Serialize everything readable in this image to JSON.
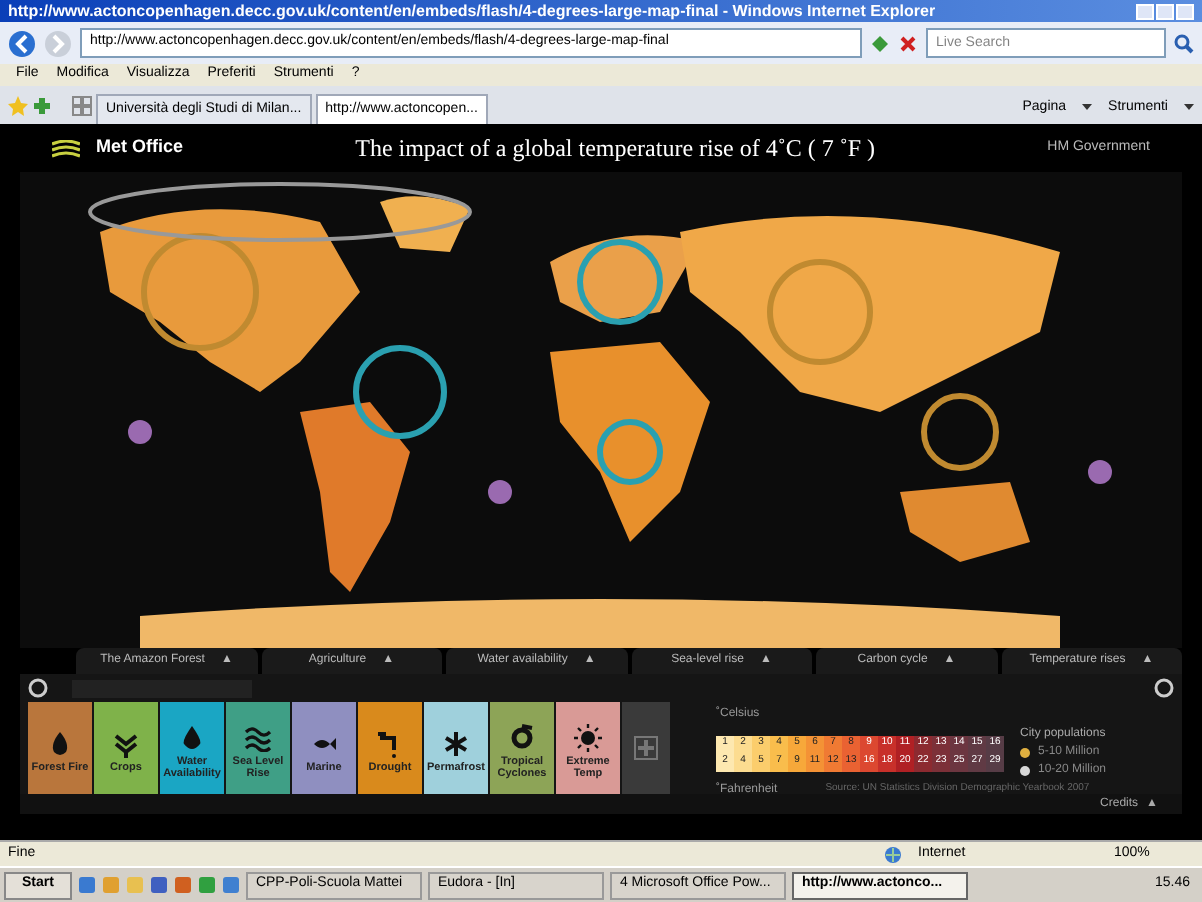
{
  "window": {
    "title": "http://www.actoncopenhagen.decc.gov.uk/content/en/embeds/flash/4-degrees-large-map-final - Windows Internet Explorer"
  },
  "address_bar": {
    "value": "http://www.actoncopenhagen.decc.gov.uk/content/en/embeds/flash/4-degrees-large-map-final"
  },
  "search": {
    "placeholder": "Live Search"
  },
  "menu": [
    "File",
    "Modifica",
    "Visualizza",
    "Preferiti",
    "Strumenti",
    "?"
  ],
  "tabs": [
    {
      "label": "Università degli Studi di Milan...",
      "selected": false
    },
    {
      "label": "http://www.actoncopen...",
      "selected": true
    }
  ],
  "toolbar": [
    "Pagina",
    "Strumenti"
  ],
  "page": {
    "logo": "Met Office",
    "title": "The impact of a global temperature rise of 4˚C ( 7 ˚F )",
    "government": "HM Government",
    "map_tabs": [
      {
        "label": "The Amazon Forest",
        "arrow": "▲"
      },
      {
        "label": "Agriculture",
        "arrow": "▲"
      },
      {
        "label": "Water availability",
        "arrow": "▲"
      },
      {
        "label": "Sea-level rise",
        "arrow": "▲"
      },
      {
        "label": "Carbon cycle",
        "arrow": "▲"
      },
      {
        "label": "Temperature rises",
        "arrow": "▲"
      }
    ],
    "impacts": [
      {
        "label": "Forest Fire",
        "color": "#b9763c"
      },
      {
        "label": "Crops",
        "color": "#7fb24a"
      },
      {
        "label": "Water Availability",
        "color": "#1aa6c4"
      },
      {
        "label": "Sea Level Rise",
        "color": "#3f9f86"
      },
      {
        "label": "Marine",
        "color": "#8f8fc0"
      },
      {
        "label": "Drought",
        "color": "#d98a1c"
      },
      {
        "label": "Permafrost",
        "color": "#9fd0dc"
      },
      {
        "label": "Tropical Cyclones",
        "color": "#8da457"
      },
      {
        "label": "Extreme Temp",
        "color": "#d99a96"
      }
    ],
    "legend": {
      "celsius_label": "˚Celsius",
      "fahrenheit_label": "˚Fahrenheit",
      "celsius": [
        "1",
        "2",
        "3",
        "4",
        "5",
        "6",
        "7",
        "8",
        "9",
        "10",
        "11",
        "12",
        "13",
        "14",
        "15",
        "16"
      ],
      "fahrenheit": [
        "2",
        "4",
        "5",
        "7",
        "9",
        "11",
        "12",
        "13",
        "16",
        "18",
        "20",
        "22",
        "23",
        "25",
        "27",
        "29"
      ],
      "source": "Source: UN Statistics Division Demographic Yearbook 2007",
      "populations_title": "City populations",
      "populations": [
        {
          "label": "5-10 Million",
          "color": "#e0b040"
        },
        {
          "label": "10-20 Million",
          "color": "#d8d8d8"
        }
      ]
    },
    "credits": "Credits",
    "credits_arrow": "▲"
  },
  "status_bar": {
    "text": "Fine",
    "zone": "Internet",
    "zoom": "100%"
  },
  "taskbar": {
    "start": "Start",
    "tasks": [
      {
        "label": "CPP-Poli-Scuola Mattei",
        "selected": false
      },
      {
        "label": "Eudora - [In]",
        "selected": false
      },
      {
        "label": "4 Microsoft Office Pow...",
        "selected": false
      },
      {
        "label": "http://www.actonco...",
        "selected": true
      }
    ],
    "clock": "15.46"
  }
}
